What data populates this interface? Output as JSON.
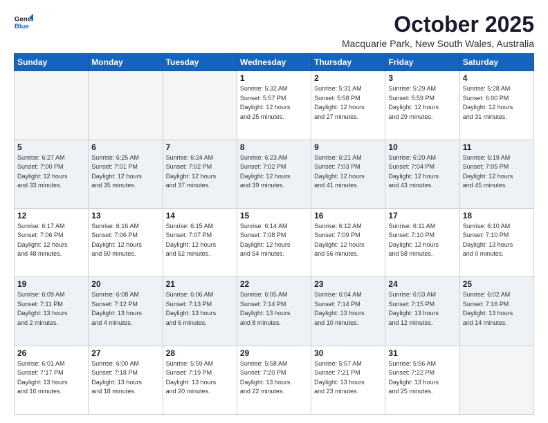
{
  "header": {
    "logo_line1": "General",
    "logo_line2": "Blue",
    "month": "October 2025",
    "location": "Macquarie Park, New South Wales, Australia"
  },
  "weekdays": [
    "Sunday",
    "Monday",
    "Tuesday",
    "Wednesday",
    "Thursday",
    "Friday",
    "Saturday"
  ],
  "weeks": [
    [
      {
        "day": "",
        "info": ""
      },
      {
        "day": "",
        "info": ""
      },
      {
        "day": "",
        "info": ""
      },
      {
        "day": "1",
        "info": "Sunrise: 5:32 AM\nSunset: 5:57 PM\nDaylight: 12 hours\nand 25 minutes."
      },
      {
        "day": "2",
        "info": "Sunrise: 5:31 AM\nSunset: 5:58 PM\nDaylight: 12 hours\nand 27 minutes."
      },
      {
        "day": "3",
        "info": "Sunrise: 5:29 AM\nSunset: 5:59 PM\nDaylight: 12 hours\nand 29 minutes."
      },
      {
        "day": "4",
        "info": "Sunrise: 5:28 AM\nSunset: 6:00 PM\nDaylight: 12 hours\nand 31 minutes."
      }
    ],
    [
      {
        "day": "5",
        "info": "Sunrise: 6:27 AM\nSunset: 7:00 PM\nDaylight: 12 hours\nand 33 minutes."
      },
      {
        "day": "6",
        "info": "Sunrise: 6:25 AM\nSunset: 7:01 PM\nDaylight: 12 hours\nand 35 minutes."
      },
      {
        "day": "7",
        "info": "Sunrise: 6:24 AM\nSunset: 7:02 PM\nDaylight: 12 hours\nand 37 minutes."
      },
      {
        "day": "8",
        "info": "Sunrise: 6:23 AM\nSunset: 7:02 PM\nDaylight: 12 hours\nand 39 minutes."
      },
      {
        "day": "9",
        "info": "Sunrise: 6:21 AM\nSunset: 7:03 PM\nDaylight: 12 hours\nand 41 minutes."
      },
      {
        "day": "10",
        "info": "Sunrise: 6:20 AM\nSunset: 7:04 PM\nDaylight: 12 hours\nand 43 minutes."
      },
      {
        "day": "11",
        "info": "Sunrise: 6:19 AM\nSunset: 7:05 PM\nDaylight: 12 hours\nand 45 minutes."
      }
    ],
    [
      {
        "day": "12",
        "info": "Sunrise: 6:17 AM\nSunset: 7:06 PM\nDaylight: 12 hours\nand 48 minutes."
      },
      {
        "day": "13",
        "info": "Sunrise: 6:16 AM\nSunset: 7:06 PM\nDaylight: 12 hours\nand 50 minutes."
      },
      {
        "day": "14",
        "info": "Sunrise: 6:15 AM\nSunset: 7:07 PM\nDaylight: 12 hours\nand 52 minutes."
      },
      {
        "day": "15",
        "info": "Sunrise: 6:14 AM\nSunset: 7:08 PM\nDaylight: 12 hours\nand 54 minutes."
      },
      {
        "day": "16",
        "info": "Sunrise: 6:12 AM\nSunset: 7:09 PM\nDaylight: 12 hours\nand 56 minutes."
      },
      {
        "day": "17",
        "info": "Sunrise: 6:11 AM\nSunset: 7:10 PM\nDaylight: 12 hours\nand 58 minutes."
      },
      {
        "day": "18",
        "info": "Sunrise: 6:10 AM\nSunset: 7:10 PM\nDaylight: 13 hours\nand 0 minutes."
      }
    ],
    [
      {
        "day": "19",
        "info": "Sunrise: 6:09 AM\nSunset: 7:11 PM\nDaylight: 13 hours\nand 2 minutes."
      },
      {
        "day": "20",
        "info": "Sunrise: 6:08 AM\nSunset: 7:12 PM\nDaylight: 13 hours\nand 4 minutes."
      },
      {
        "day": "21",
        "info": "Sunrise: 6:06 AM\nSunset: 7:13 PM\nDaylight: 13 hours\nand 6 minutes."
      },
      {
        "day": "22",
        "info": "Sunrise: 6:05 AM\nSunset: 7:14 PM\nDaylight: 13 hours\nand 8 minutes."
      },
      {
        "day": "23",
        "info": "Sunrise: 6:04 AM\nSunset: 7:14 PM\nDaylight: 13 hours\nand 10 minutes."
      },
      {
        "day": "24",
        "info": "Sunrise: 6:03 AM\nSunset: 7:15 PM\nDaylight: 13 hours\nand 12 minutes."
      },
      {
        "day": "25",
        "info": "Sunrise: 6:02 AM\nSunset: 7:16 PM\nDaylight: 13 hours\nand 14 minutes."
      }
    ],
    [
      {
        "day": "26",
        "info": "Sunrise: 6:01 AM\nSunset: 7:17 PM\nDaylight: 13 hours\nand 16 minutes."
      },
      {
        "day": "27",
        "info": "Sunrise: 6:00 AM\nSunset: 7:18 PM\nDaylight: 13 hours\nand 18 minutes."
      },
      {
        "day": "28",
        "info": "Sunrise: 5:59 AM\nSunset: 7:19 PM\nDaylight: 13 hours\nand 20 minutes."
      },
      {
        "day": "29",
        "info": "Sunrise: 5:58 AM\nSunset: 7:20 PM\nDaylight: 13 hours\nand 22 minutes."
      },
      {
        "day": "30",
        "info": "Sunrise: 5:57 AM\nSunset: 7:21 PM\nDaylight: 13 hours\nand 23 minutes."
      },
      {
        "day": "31",
        "info": "Sunrise: 5:56 AM\nSunset: 7:22 PM\nDaylight: 13 hours\nand 25 minutes."
      },
      {
        "day": "",
        "info": ""
      }
    ]
  ]
}
